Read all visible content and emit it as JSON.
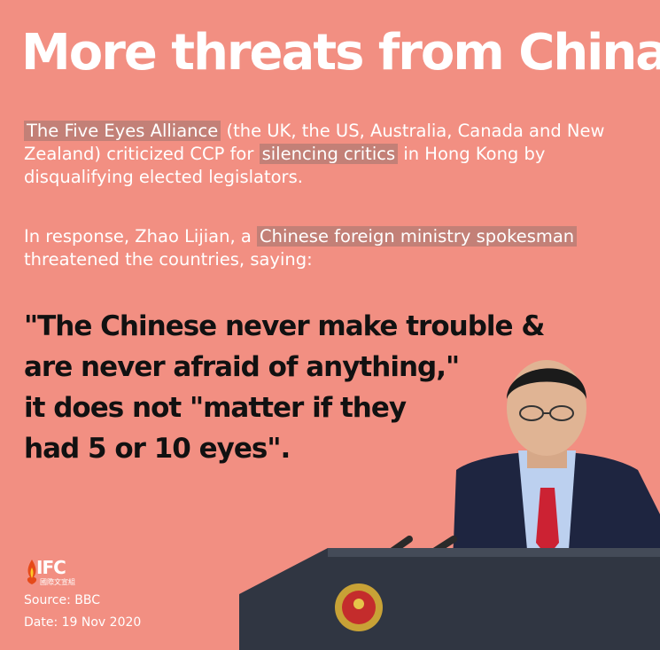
{
  "headline": "More threats from China!",
  "paragraph1": {
    "highlight_alliance": "The Five Eyes Alliance",
    "text_a": " (the UK, the US, Australia, Canada and New Zealand) criticized CCP for ",
    "highlight_critics": "silencing critics",
    "text_b": " in Hong Kong by disqualifying elected legislators."
  },
  "paragraph2": {
    "text_a": "In response, Zhao Lijian, a ",
    "highlight_spokesman": "Chinese foreign ministry spokesman",
    "text_b": " threatened the countries, saying:"
  },
  "quote_lines": [
    "\"The Chinese never make trouble &",
    "are never afraid of anything,\"",
    "it does not \"matter if they",
    "had 5 or 10 eyes\"."
  ],
  "logo": {
    "name": "IFC",
    "subtitle": "國際文宣組"
  },
  "source": "Source: BBC",
  "date": "Date: 19 Nov 2020",
  "colors": {
    "background": "#f28f82",
    "text_light": "#ffffff",
    "text_dark": "#111111",
    "highlight": "#b27a77"
  }
}
